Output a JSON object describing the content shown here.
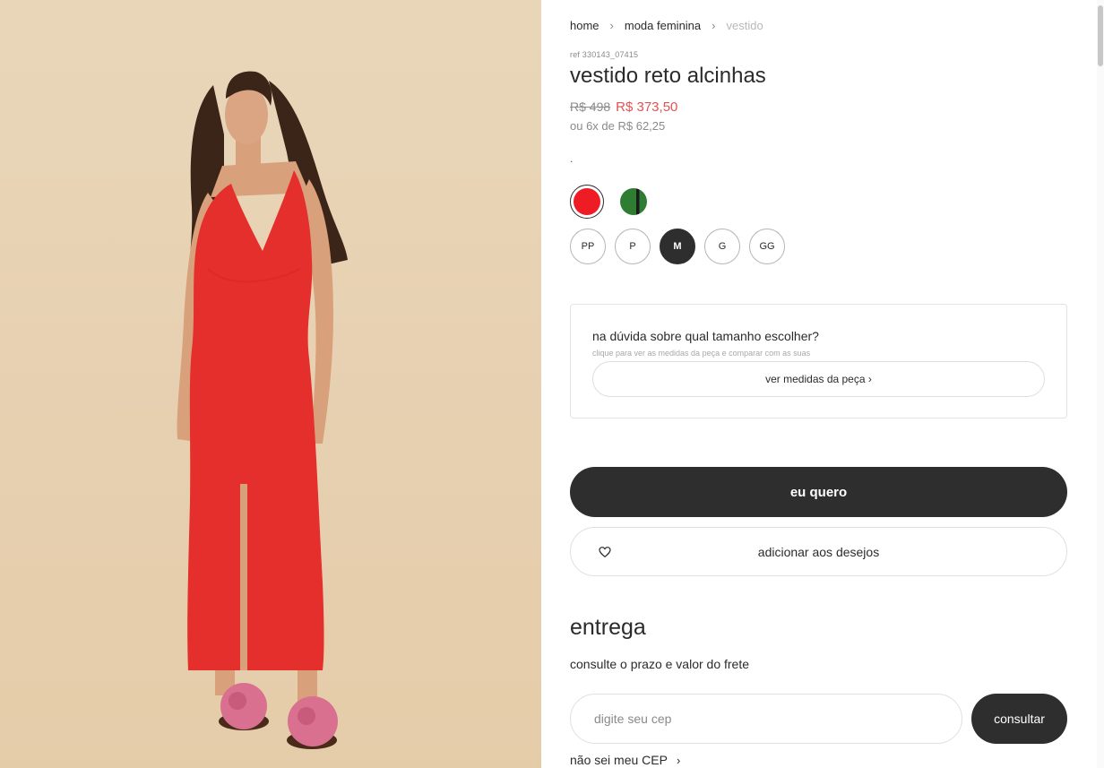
{
  "photo": {
    "alt": "modelo usando vestido reto alcinhas vermelho"
  },
  "breadcrumb": [
    {
      "label": "home"
    },
    {
      "label": "moda feminina"
    },
    {
      "label": "vestido"
    }
  ],
  "product": {
    "ref": "ref 330143_07415",
    "title": "vestido reto alcinhas",
    "old_price": "R$ 498",
    "price": "R$ 373,50",
    "installments": "ou 6x de R$ 62,25",
    "color_label": "."
  },
  "colors": [
    {
      "name": "vermelho",
      "hex": "#ee1c25",
      "selected": true
    },
    {
      "name": "verde",
      "hex": "#2e7d32",
      "selected": false
    }
  ],
  "sizes": [
    {
      "label": "PP",
      "selected": false
    },
    {
      "label": "P",
      "selected": false
    },
    {
      "label": "M",
      "selected": true
    },
    {
      "label": "G",
      "selected": false
    },
    {
      "label": "GG",
      "selected": false
    }
  ],
  "size_help": {
    "question": "na dúvida sobre qual tamanho escolher?",
    "hint": "clique para ver as medidas da peça e comparar com as suas",
    "button": "ver medidas da peça ›"
  },
  "actions": {
    "buy": "eu quero",
    "wishlist": "adicionar aos desejos"
  },
  "delivery": {
    "title": "entrega",
    "subtitle": "consulte o prazo e valor do frete",
    "placeholder": "digite seu cep",
    "button": "consultar",
    "no_cep": "não sei meu CEP"
  },
  "theme": {
    "accent_dark": "#2e2e2e",
    "sale_red": "#e0534f"
  }
}
